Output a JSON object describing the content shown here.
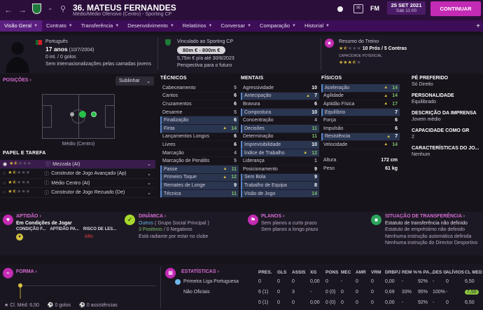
{
  "header": {
    "player_name": "36. MATEUS FERNANDES",
    "subtitle": "Médio/Médio Ofensivo (Centro) - Sporting CP",
    "fm_label": "FM",
    "date": "25 SET 2021",
    "day_time": "Sáb 11:00",
    "continue_label": "CONTINUAR"
  },
  "nav": {
    "tabs": [
      "Visão Geral",
      "Contrato",
      "Transferência",
      "Desenvolvimento",
      "Relatórios",
      "Conversar",
      "Comparação",
      "Historial"
    ]
  },
  "summary": {
    "nationality": "Português",
    "age": "17 anos",
    "birthdate": "(10/7/2004)",
    "intl": "0 int. / 0 golos",
    "no_youth_intl": "Sem internacionalizações pelas camadas jovens",
    "linked_label": "Vinculado ao Sporting CP",
    "value": "80m € - 800m €",
    "wage": "5,75m € p/a até 30/6/2023",
    "outlook": "Perspectiva para o futuro",
    "training_label": "Resumo do Treino",
    "training_value": "10 Prós / 5 Contras",
    "potential_label": "CAPACIDADE POTENCIAL",
    "current_stars": 1.5,
    "potential_stars": 3.5
  },
  "positions": {
    "title": "POSIÇÕES",
    "highlight_label": "Sublinhar",
    "position_label": "Médio (Centro)",
    "role_title": "PAPEL E TAREFA",
    "roles": [
      {
        "name": "Mezzala (At)",
        "stars": 1.5
      },
      {
        "name": "Construtor de Jogo Avançado (Ap)",
        "stars": 1.5
      },
      {
        "name": "Médio Centro (At)",
        "stars": 1.5
      },
      {
        "name": "Construtor de Jogo Recuado (De)",
        "stars": 1.5
      }
    ]
  },
  "technical": {
    "title": "TÉCNICOS",
    "rows": [
      {
        "name": "Cabeceamento",
        "value": "5",
        "hl": false,
        "up": false,
        "tone": "dim"
      },
      {
        "name": "Cantos",
        "value": "6",
        "hl": false,
        "up": false,
        "tone": ""
      },
      {
        "name": "Cruzamentos",
        "value": "6",
        "hl": false,
        "up": false,
        "tone": ""
      },
      {
        "name": "Desarme",
        "value": "5",
        "hl": false,
        "up": false,
        "tone": "dim"
      },
      {
        "name": "Finalização",
        "value": "6",
        "hl": true,
        "up": false,
        "tone": ""
      },
      {
        "name": "Finta",
        "value": "14",
        "hl": true,
        "up": true,
        "tone": "g"
      },
      {
        "name": "Lançamentos Longos",
        "value": "6",
        "hl": false,
        "up": false,
        "tone": ""
      },
      {
        "name": "Livres",
        "value": "6",
        "hl": false,
        "up": false,
        "tone": ""
      },
      {
        "name": "Marcação",
        "value": "4",
        "hl": false,
        "up": false,
        "tone": "dim"
      },
      {
        "name": "Marcação de Penáltis",
        "value": "5",
        "hl": false,
        "up": false,
        "tone": "dim"
      },
      {
        "name": "Passe",
        "value": "11",
        "hl": true,
        "up": true,
        "tone": "g"
      },
      {
        "name": "Primeiro Toque",
        "value": "12",
        "hl": true,
        "up": true,
        "tone": "g"
      },
      {
        "name": "Remates de Longe",
        "value": "9",
        "hl": true,
        "up": false,
        "tone": ""
      },
      {
        "name": "Técnica",
        "value": "11",
        "hl": true,
        "up": false,
        "tone": "g"
      }
    ]
  },
  "mental": {
    "title": "MENTAIS",
    "rows": [
      {
        "name": "Agressividade",
        "value": "10",
        "hl": false,
        "up": false,
        "tone": ""
      },
      {
        "name": "Antecipação",
        "value": "7",
        "hl": true,
        "up": true,
        "tone": ""
      },
      {
        "name": "Bravura",
        "value": "6",
        "hl": false,
        "up": false,
        "tone": ""
      },
      {
        "name": "Compostura",
        "value": "10",
        "hl": true,
        "up": false,
        "tone": ""
      },
      {
        "name": "Concentração",
        "value": "4",
        "hl": false,
        "up": false,
        "tone": "dim"
      },
      {
        "name": "Decisões",
        "value": "11",
        "hl": true,
        "up": false,
        "tone": "g"
      },
      {
        "name": "Determinação",
        "value": "11",
        "hl": false,
        "up": false,
        "tone": "g"
      },
      {
        "name": "Imprevisibilidade",
        "value": "10",
        "hl": true,
        "up": false,
        "tone": ""
      },
      {
        "name": "Índice de Trabalho",
        "value": "12",
        "hl": true,
        "up": true,
        "tone": "g"
      },
      {
        "name": "Liderança",
        "value": "1",
        "hl": false,
        "up": false,
        "tone": "dim"
      },
      {
        "name": "Posicionamento",
        "value": "9",
        "hl": false,
        "up": false,
        "tone": ""
      },
      {
        "name": "Sem Bola",
        "value": "9",
        "hl": true,
        "up": false,
        "tone": ""
      },
      {
        "name": "Trabalho de Equipa",
        "value": "8",
        "hl": true,
        "up": false,
        "tone": ""
      },
      {
        "name": "Visão de Jogo",
        "value": "14",
        "hl": true,
        "up": false,
        "tone": "g"
      }
    ]
  },
  "physical": {
    "title": "FÍSICOS",
    "rows": [
      {
        "name": "Aceleração",
        "value": "14",
        "hl": true,
        "up": true,
        "tone": "g"
      },
      {
        "name": "Agilidade",
        "value": "14",
        "hl": false,
        "up": true,
        "tone": "g"
      },
      {
        "name": "Aptidão Física",
        "value": "17",
        "hl": false,
        "up": true,
        "tone": "g"
      },
      {
        "name": "Equilíbrio",
        "value": "7",
        "hl": true,
        "up": false,
        "tone": ""
      },
      {
        "name": "Força",
        "value": "6",
        "hl": false,
        "up": false,
        "tone": ""
      },
      {
        "name": "Impulsão",
        "value": "6",
        "hl": false,
        "up": false,
        "tone": ""
      },
      {
        "name": "Resistência",
        "value": "7",
        "hl": true,
        "up": true,
        "tone": ""
      },
      {
        "name": "Velocidade",
        "value": "14",
        "hl": false,
        "up": true,
        "tone": "g"
      }
    ],
    "height_label": "Altura",
    "height": "172 cm",
    "weight_label": "Peso",
    "weight": "61 kg"
  },
  "right": {
    "items": [
      {
        "title": "PÉ PREFERIDO",
        "value": "Só Direito"
      },
      {
        "title": "PERSONALIDADE",
        "value": "Equilibrado"
      },
      {
        "title": "DESCRIÇÃO DA IMPRENSA",
        "value": "Jovem médio"
      },
      {
        "title": "CAPACIDADE COMO GR",
        "value": "2"
      },
      {
        "title": "CARACTERÍSTICAS DO JO...",
        "value": "Nenhum"
      }
    ]
  },
  "cards": {
    "fitness_title": "APTIDÃO",
    "fitness_value": "Em Condições de Jogar",
    "cond_label": "CONDIÇÃO F...",
    "match_label": "APTIDÃO PA...",
    "injury_label": "RISCO DE LES...",
    "injury_value": "Alto",
    "dynamics_title": "DINÂMICA",
    "dyn_group": "Outros",
    "dyn_group_sub": "( Grupo Social Principal )",
    "dyn_positives": "3 Positivos",
    "dyn_negatives": "/ 0 Negativos",
    "dyn_text": "Está radiante por estar no clube",
    "plans_title": "PLANOS",
    "plans_short": "Sem planos a curto prazo",
    "plans_long": "Sem planos a longo prazo",
    "transfer_title": "SITUAÇÃO DE TRANSFERÊNCIA",
    "transfer_status": "Estatuto de transferência não definido",
    "loan_status": "Estatuto de empréstimo não definido",
    "auto_transfer": "Nenhuma instrução automática definida",
    "director_transfer": "Nenhuma instrução do Director Desportivo"
  },
  "form": {
    "title": "FORMA",
    "avg_label": "Cl. Méd: 6,50",
    "goals": "0 golos",
    "assists": "0 assistências"
  },
  "stats": {
    "title": "ESTATÍSTICAS",
    "headers": [
      "PRES.",
      "GLS",
      "ASSIS",
      "XG",
      "PONS",
      "MEC",
      "AMR",
      "VRM",
      "DRBPJ",
      "REM %",
      "% PA...",
      "DES G",
      "ALÍVIOS",
      "CL MED"
    ],
    "rows": [
      {
        "name": "Primeira Liga Portuguesa",
        "cells": [
          "0",
          "0",
          "0",
          "0,00",
          "0",
          "-",
          "0",
          "0",
          "0,00",
          "-",
          "92%",
          "-",
          "0",
          "6,50"
        ]
      },
      {
        "name": "Não Oficiais",
        "cells": [
          "6 (1)",
          "0",
          "3",
          "-",
          "0 (0)",
          "0",
          "0",
          "0",
          "0,69",
          "33%",
          "95%",
          "100%",
          "-",
          "7,50"
        ]
      },
      {
        "name": "",
        "cells": [
          "0 (1)",
          "0",
          "0",
          "0,00",
          "0 (0)",
          "0",
          "0",
          "0",
          "0,00",
          "-",
          "92%",
          "-",
          "0",
          "6,50"
        ]
      }
    ]
  }
}
